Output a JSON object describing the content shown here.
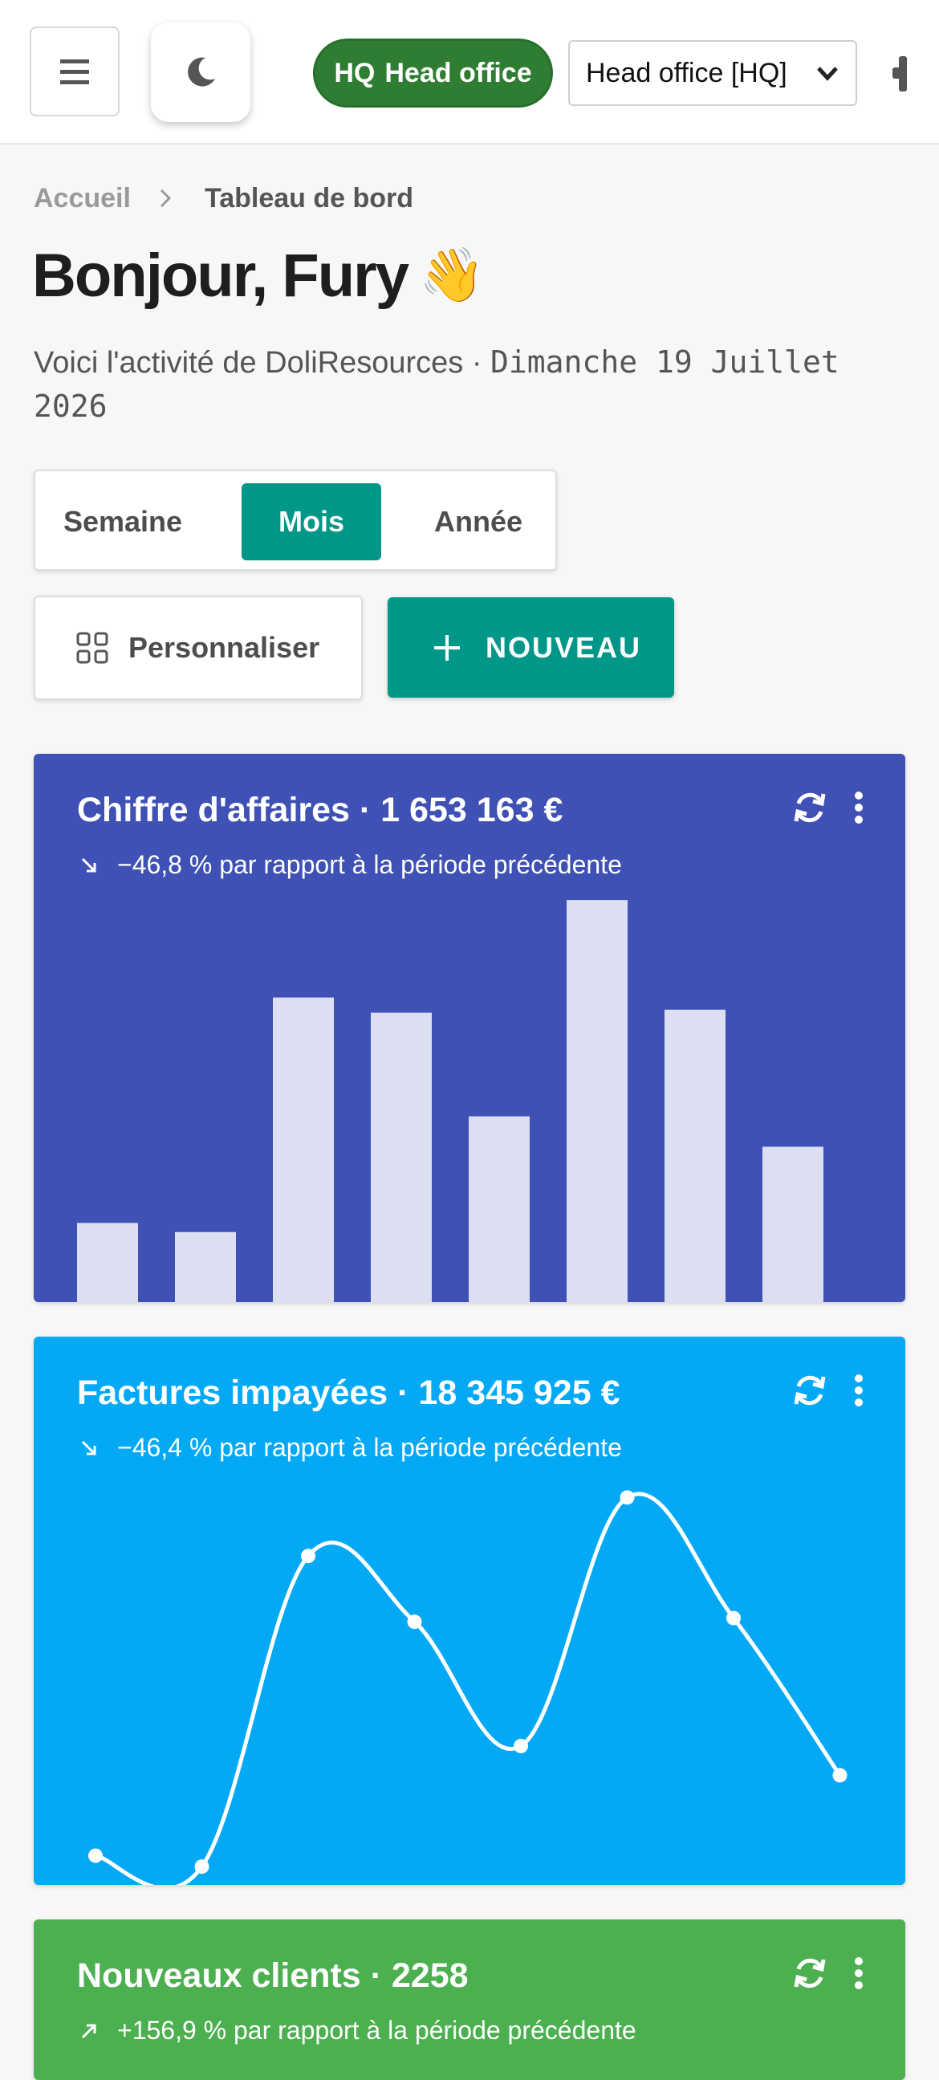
{
  "topbar": {
    "menu_icon": "hamburger-menu-icon",
    "theme_icon": "moon-icon",
    "entity_badge": {
      "code": "HQ",
      "name": "Head office",
      "color": "#2e7d32"
    },
    "entity_select": {
      "value": "Head office [HQ]"
    }
  },
  "breadcrumb": {
    "home": "Accueil",
    "current": "Tableau de bord"
  },
  "greeting": {
    "text": "Bonjour, Fury",
    "emoji": "👋"
  },
  "subtitle": {
    "text": "Voici l'activité de DoliResources · ",
    "date": "Dimanche 19 Juillet 2026"
  },
  "period": {
    "options": [
      "Semaine",
      "Mois",
      "Année"
    ],
    "selected": "Mois",
    "accent": "#009688"
  },
  "actions": {
    "customize": "Personnaliser",
    "new": "NOUVEAU"
  },
  "cards": [
    {
      "title": "Chiffre d'affaires · 1 653 163 €",
      "delta": "−46,8 % par rapport à la période précédente",
      "color": "#3f51b5"
    },
    {
      "title": "Factures impayées · 18 345 925 €",
      "delta": "−46,4 % par rapport à la période précédente",
      "color": "#03a9f4"
    },
    {
      "title": "Nouveaux clients · 2258",
      "delta": "+156,9 % par rapport à la période précédente",
      "color": "#4caf50"
    }
  ],
  "chart_data": [
    {
      "type": "bar",
      "categories": [
        "1",
        "2",
        "3",
        "4",
        "5",
        "6",
        "7",
        "8"
      ],
      "values": [
        0.26,
        0.23,
        1.0,
        0.95,
        0.61,
        1.32,
        0.96,
        0.51
      ],
      "ylim": [
        0,
        1.8
      ],
      "grid": false,
      "bar_color": "#dcdff2"
    },
    {
      "type": "line",
      "x": [
        1,
        2,
        3,
        4,
        5,
        6,
        7,
        8
      ],
      "values": [
        0.08,
        0.05,
        0.9,
        0.72,
        0.38,
        1.06,
        0.73,
        0.3
      ],
      "ylim": [
        0,
        1.5
      ],
      "grid": false,
      "smooth": true,
      "line_color": "#ffffff"
    }
  ]
}
